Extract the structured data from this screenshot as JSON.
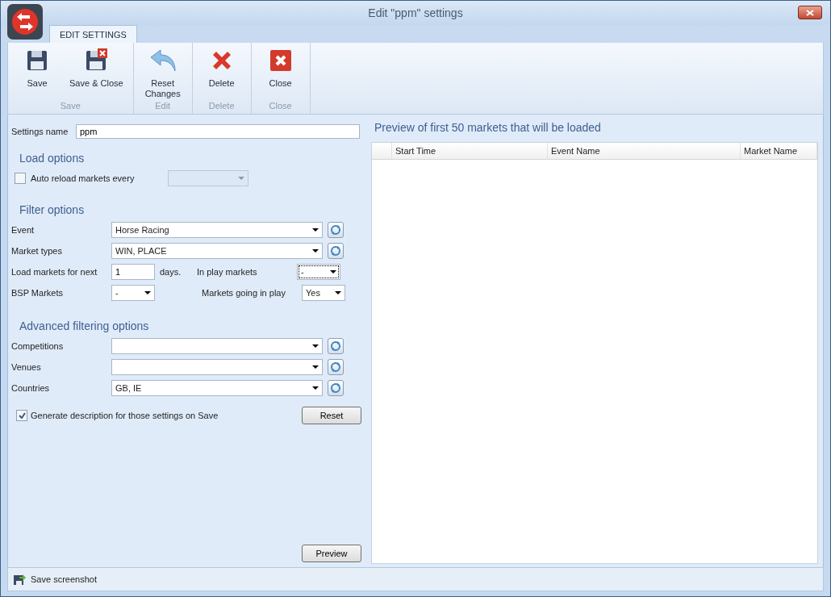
{
  "window": {
    "title": "Edit \"ppm\" settings"
  },
  "tabs": [
    {
      "label": "EDIT SETTINGS",
      "selected": true
    }
  ],
  "ribbon": [
    {
      "label": "Save",
      "buttons": [
        {
          "kind": "save",
          "label": "Save"
        },
        {
          "kind": "save-close",
          "label": "Save & Close"
        }
      ]
    },
    {
      "label": "Edit",
      "buttons": [
        {
          "kind": "undo",
          "label": "Reset Changes"
        }
      ]
    },
    {
      "label": "Delete",
      "buttons": [
        {
          "kind": "delete",
          "label": "Delete"
        }
      ]
    },
    {
      "label": "Close",
      "buttons": [
        {
          "kind": "close",
          "label": "Close"
        }
      ]
    }
  ],
  "settings_name": {
    "label": "Settings name",
    "value": "ppm"
  },
  "load_options": {
    "title": "Load options",
    "auto_reload": {
      "label": "Auto reload markets every",
      "checked": false,
      "disabled": true
    }
  },
  "filter_options": {
    "title": "Filter options",
    "combos": [
      {
        "label": "Event",
        "value": "Horse Racing"
      },
      {
        "label": "Market types",
        "value": "WIN, PLACE"
      }
    ],
    "load_next": {
      "label": "Load markets for next",
      "value": "1",
      "suffix": "days."
    },
    "bsp": {
      "label": "BSP Markets",
      "value": "-"
    },
    "in_play": {
      "label": "In play markets",
      "value": "-",
      "focused": true
    },
    "going_in_play": {
      "label": "Markets going in play",
      "value": "Yes",
      "focused": false
    }
  },
  "advanced_options": {
    "title": "Advanced filtering options",
    "combos": [
      {
        "label": "Competitions"
      },
      {
        "label": "Venues"
      },
      {
        "label": "Countries",
        "value": "GB, IE"
      }
    ]
  },
  "generate_description": {
    "label": "Generate description for those settings on Save",
    "checked": true
  },
  "reset_button": "Reset",
  "preview_button": "Preview",
  "preview": {
    "title": "Preview of first 50 markets that will be loaded",
    "columns": [
      "Start Time",
      "Event Name",
      "Market Name"
    ]
  },
  "status_bar": {
    "label": "Save screenshot"
  }
}
